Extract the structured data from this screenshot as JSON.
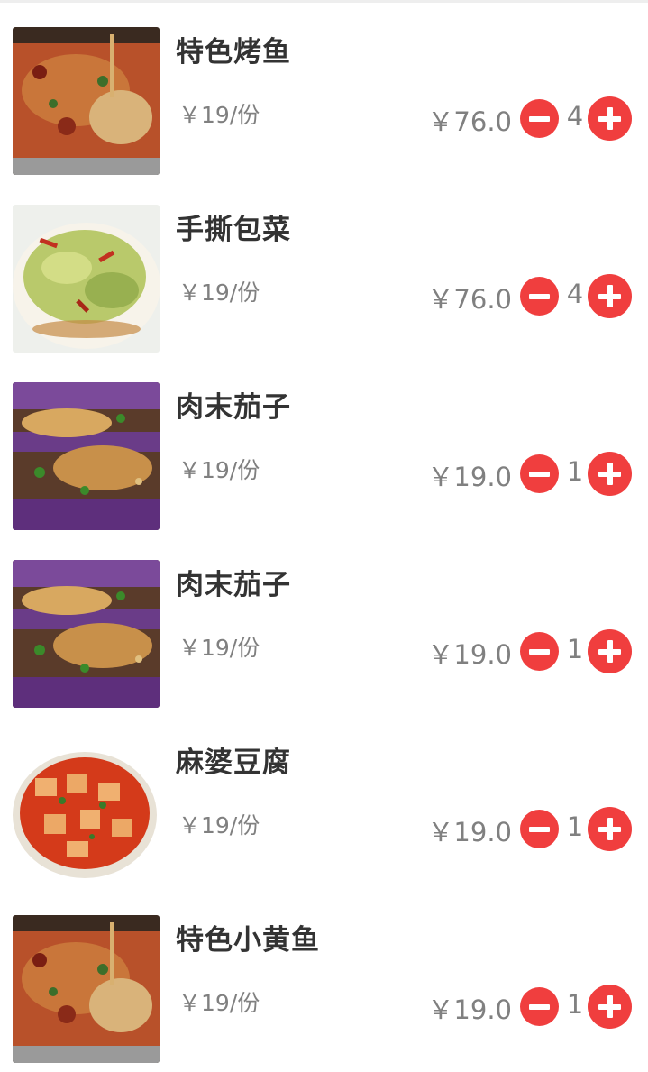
{
  "cart": {
    "items": [
      {
        "name": "特色烤鱼",
        "unit_price": "￥19/份",
        "total": "￥76.0",
        "quantity": "4",
        "image": "grilled-fish"
      },
      {
        "name": "手撕包菜",
        "unit_price": "￥19/份",
        "total": "￥76.0",
        "quantity": "4",
        "image": "shredded-cabbage"
      },
      {
        "name": "肉末茄子",
        "unit_price": "￥19/份",
        "total": "￥19.0",
        "quantity": "1",
        "image": "eggplant"
      },
      {
        "name": "肉末茄子",
        "unit_price": "￥19/份",
        "total": "￥19.0",
        "quantity": "1",
        "image": "eggplant"
      },
      {
        "name": "麻婆豆腐",
        "unit_price": "￥19/份",
        "total": "￥19.0",
        "quantity": "1",
        "image": "mapo-tofu"
      },
      {
        "name": "特色小黄鱼",
        "unit_price": "￥19/份",
        "total": "￥19.0",
        "quantity": "1",
        "image": "grilled-fish"
      }
    ]
  },
  "colors": {
    "accent": "#f03e3e",
    "title_text": "#333333",
    "secondary_text": "#808080"
  },
  "icons": {
    "decrease": "minus-circle-icon",
    "increase": "plus-circle-icon"
  }
}
